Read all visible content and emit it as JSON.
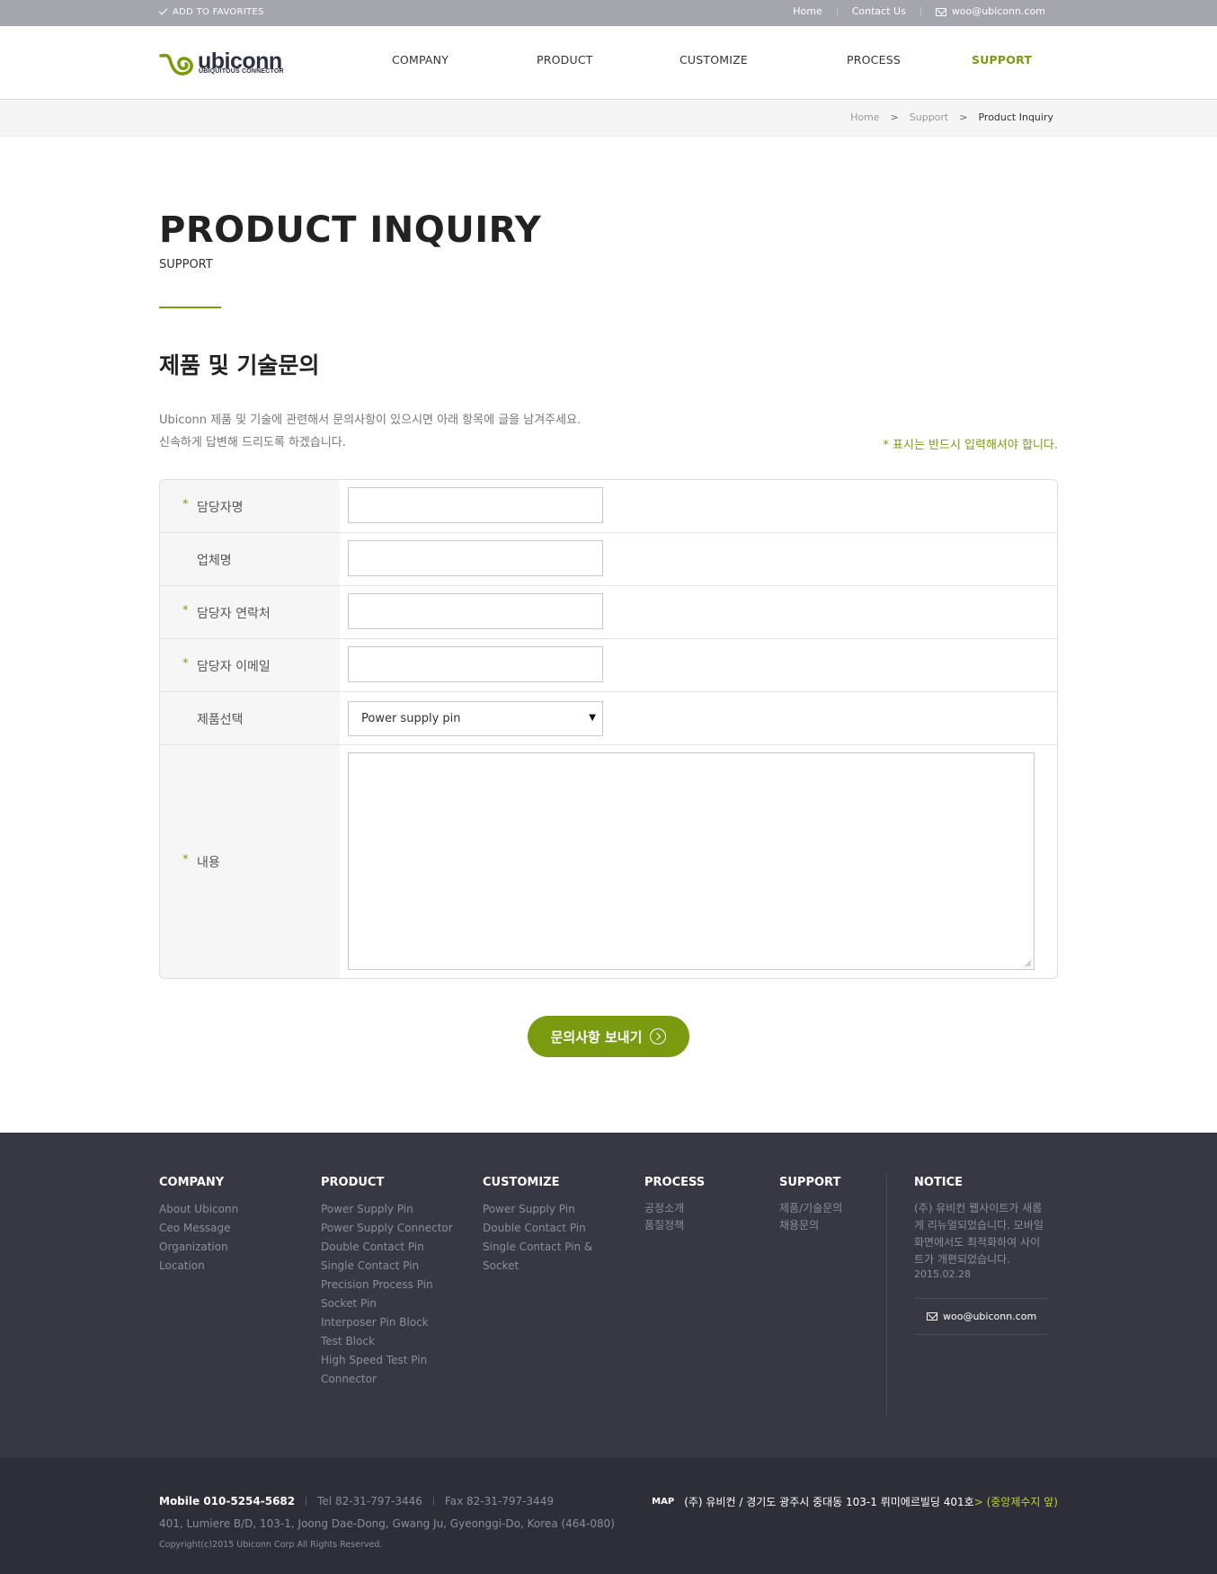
{
  "topbar": {
    "favorites": "ADD TO FAVORITES",
    "home": "Home",
    "contact": "Contact Us",
    "email": "woo@ubiconn.com"
  },
  "logo": {
    "name": "ubiconn",
    "tagline": "UBIQUITOUS CONNECTOR"
  },
  "nav": [
    {
      "label": "COMPANY"
    },
    {
      "label": "PRODUCT"
    },
    {
      "label": "CUSTOMIZE"
    },
    {
      "label": "PROCESS"
    },
    {
      "label": "SUPPORT",
      "active": true
    }
  ],
  "breadcrumb": [
    "Home",
    "Support",
    "Product Inquiry"
  ],
  "page": {
    "title": "PRODUCT INQUIRY",
    "subtitle": "SUPPORT",
    "section_title": "제품 및 기술문의",
    "intro_line1": "Ubiconn 제품 및 기술에 관련해서 문의사항이 있으시면 아래 항목에 글을 남겨주세요.",
    "intro_line2": "신속하게 답변해 드리도록 하겠습니다.",
    "required_note": "*  표시는 반드시 입력해셔야 합니다."
  },
  "form": {
    "fields": [
      {
        "label": "담당자명",
        "required": true,
        "value": ""
      },
      {
        "label": "업체명",
        "required": false,
        "value": ""
      },
      {
        "label": "담당자 연락처",
        "required": true,
        "value": ""
      },
      {
        "label": "담당자 이메일",
        "required": true,
        "value": ""
      },
      {
        "label": "제품선택",
        "required": false,
        "value": "Power supply pin"
      },
      {
        "label": "내용",
        "required": true,
        "value": ""
      }
    ],
    "star": "*",
    "submit_label": "문의사항 보내기"
  },
  "footer": {
    "company": {
      "title": "COMPANY",
      "items": [
        "About Ubiconn",
        "Ceo Message",
        "Organization",
        "Location"
      ]
    },
    "product": {
      "title": "PRODUCT",
      "items": [
        "Power Supply Pin",
        "Power Supply Connector",
        "Double Contact Pin",
        "Single Contact Pin",
        "Precision Process Pin",
        "Socket Pin",
        "Interposer Pin Block",
        "Test Block",
        "High Speed Test Pin",
        "Connector"
      ]
    },
    "customize": {
      "title": "CUSTOMIZE",
      "items": [
        "Power Supply Pin",
        "Double Contact Pin",
        "Single Contact Pin &",
        "Socket"
      ]
    },
    "process": {
      "title": "PROCESS",
      "items": [
        "공정소개",
        "품질정책"
      ]
    },
    "support": {
      "title": "SUPPORT",
      "items": [
        "제품/기술문의",
        "채용문의"
      ]
    },
    "notice": {
      "title": "NOTICE",
      "text": "(주) 유비컨 웹사이트가 새롭게 리뉴얼되었습니다. 모바일화면에서도 최적화하여 사이트가 개편되었습니다.",
      "date": "2015.02.28",
      "email": "woo@ubiconn.com"
    }
  },
  "bottom": {
    "mobile": "Mobile 010-5254-5682",
    "tel": "Tel 82-31-797-3446",
    "fax": "Fax 82-31-797-3449",
    "address": "401, Lumiere B/D, 103-1, Joong Dae-Dong, Gwang Ju, Gyeonggi-Do, Korea (464-080)",
    "copyright": "Copyright(c)2015 Ubiconn Corp All Rights Reserved.",
    "map_label": "MAP",
    "map_address": "(주) 유비컨 / 경기도 광주시 중대동 103-1 뤼미에르빌딩 401호",
    "map_hint": " > (중앙제수지 앞)"
  },
  "colors": {
    "accent": "#7a9b10",
    "topbar": "#a5a5ae",
    "footer": "#383844",
    "bottombar": "#2e2e38"
  }
}
